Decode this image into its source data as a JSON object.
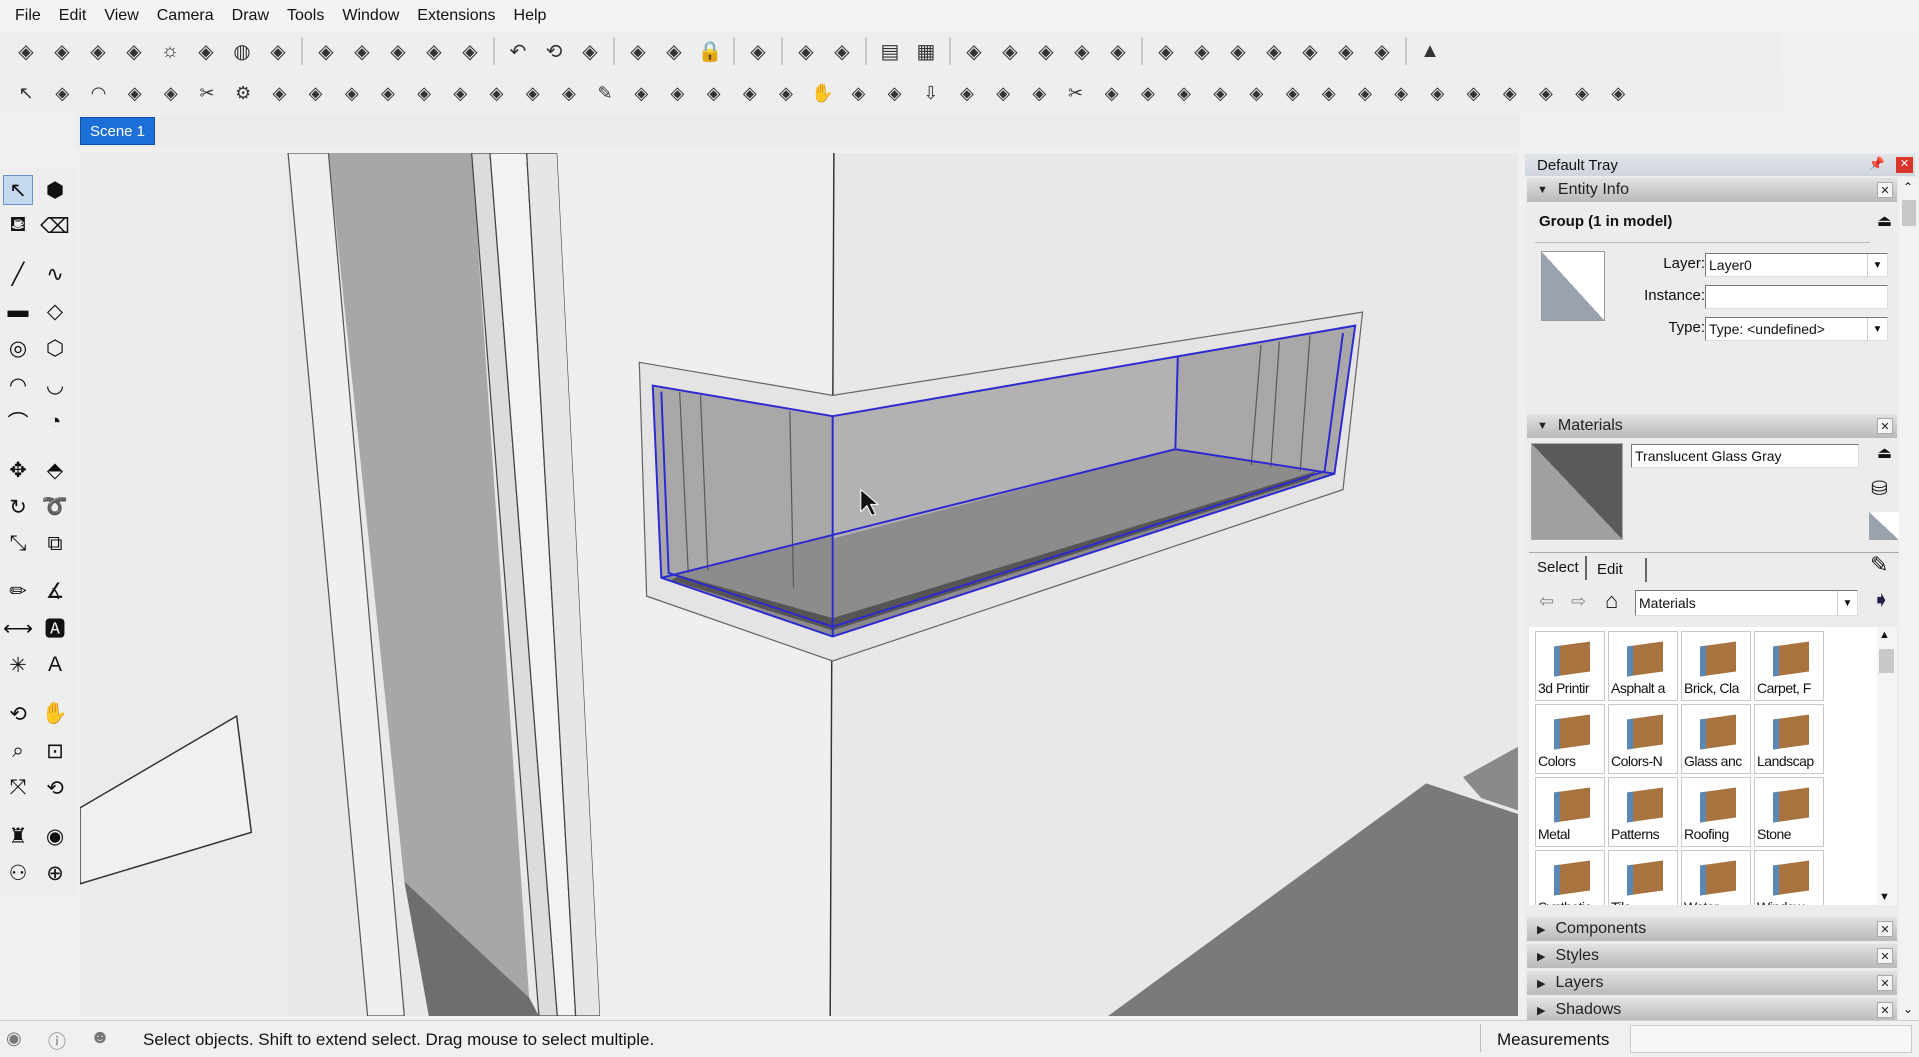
{
  "menu": [
    "File",
    "Edit",
    "View",
    "Camera",
    "Draw",
    "Tools",
    "Window",
    "Extensions",
    "Help"
  ],
  "toolbar_row1": [
    "standard-views-icon",
    "iso-icon",
    "top-icon",
    "front-icon",
    "sun-icon",
    "shaded-icon",
    "globe-icon",
    "lighting-icon",
    "|",
    "xray-icon",
    "wireframe-icon",
    "hidden-line-icon",
    "sandbox-icon",
    "drape-icon",
    "|",
    "undo-icon",
    "orbit-icon",
    "component-icon",
    "|",
    "layers-icon",
    "outliner-icon",
    "lock-icon",
    "|",
    "disabled-icon",
    "|",
    "scene-icon",
    "points-icon",
    "|",
    "book-icon",
    "grid-icon",
    "|",
    "warehouse-icon",
    "extension-icon",
    "dome-icon",
    "photo-icon",
    "texture-icon",
    "|",
    "export1-icon",
    "export2-icon",
    "export3-icon",
    "export4-icon",
    "export5-icon",
    "export6-icon",
    "export7-icon",
    "|",
    "pyramid-icon"
  ],
  "toolbar_row2_count_label": "",
  "toolbar_row2": [
    "select-icon",
    "circle-tool-icon",
    "arc-icon",
    "paint-icon",
    "box-icon",
    "cut-icon",
    "gear-icon",
    "shape-icon",
    "curve-icon",
    "bend-icon",
    "solid-icon",
    "knife-icon",
    "sphere-icon",
    "loft-icon",
    "corner-icon",
    "angle-icon",
    "pencil-icon",
    "sweep-icon",
    "frame-icon",
    "cone-icon",
    "stair-icon",
    "cube-icon",
    "hand-icon",
    "chain-icon",
    "plane-icon",
    "arrow-icon",
    "panels-icon",
    "tee-icon",
    "push-icon",
    "scissor-icon",
    "ribbon-icon",
    "wedge-icon",
    "hinge-icon",
    "post-icon",
    "beam-icon",
    "block-icon",
    "stack-icon",
    "fence-icon",
    "ridge-icon",
    "tile-icon",
    "hex-icon",
    "wave-icon",
    "box-green-icon",
    "box-green2-icon",
    "box-green3-icon"
  ],
  "scene_tab": "Scene 1",
  "left_tools": [
    "select-icon",
    "make-component-icon",
    "paint-bucket-icon",
    "eraser-icon",
    "line-icon",
    "freehand-icon",
    "rectangle-icon",
    "rotated-rectangle-icon",
    "circle-icon",
    "polygon-icon",
    "arc-icon",
    "two-point-arc-icon",
    "three-point-arc-icon",
    "pie-icon",
    "move-icon",
    "push-pull-icon",
    "rotate-icon",
    "follow-me-icon",
    "scale-icon",
    "offset-icon",
    "tape-measure-icon",
    "protractor-icon",
    "dimension-icon",
    "text-icon",
    "axes-icon",
    "three-d-text-icon",
    "orbit-icon",
    "pan-icon",
    "zoom-icon",
    "zoom-window-icon",
    "zoom-extents-icon",
    "previous-view-icon",
    "position-camera-icon",
    "look-around-icon",
    "walk-icon",
    "section-plane-icon"
  ],
  "tray": {
    "title": "Default Tray",
    "entity_info": {
      "title": "Entity Info",
      "selection": "Group (1 in model)",
      "layer_label": "Layer:",
      "layer_value": "Layer0",
      "instance_label": "Instance:",
      "instance_value": "",
      "type_label": "Type:",
      "type_value": "Type: <undefined>"
    },
    "materials": {
      "title": "Materials",
      "name": "Translucent Glass Gray",
      "tabs": [
        "Select",
        "Edit"
      ],
      "library": "Materials",
      "items": [
        "3d Printir",
        "Asphalt a",
        "Brick, Cla",
        "Carpet, F",
        "Colors",
        "Colors-N",
        "Glass anc",
        "Landscap",
        "Metal",
        "Patterns",
        "Roofing",
        "Stone",
        "Synthetic",
        "Tile",
        "Water",
        "Window"
      ]
    },
    "collapsed": [
      "Components",
      "Styles",
      "Layers",
      "Shadows"
    ]
  },
  "status": {
    "hint": "Select objects. Shift to extend select. Drag mouse to select multiple.",
    "measurements_label": "Measurements",
    "measurements_value": ""
  },
  "colors": {
    "selection": "#2a2ad0",
    "scene_tab": "#1c6fd6",
    "folder": "#a9733f"
  }
}
